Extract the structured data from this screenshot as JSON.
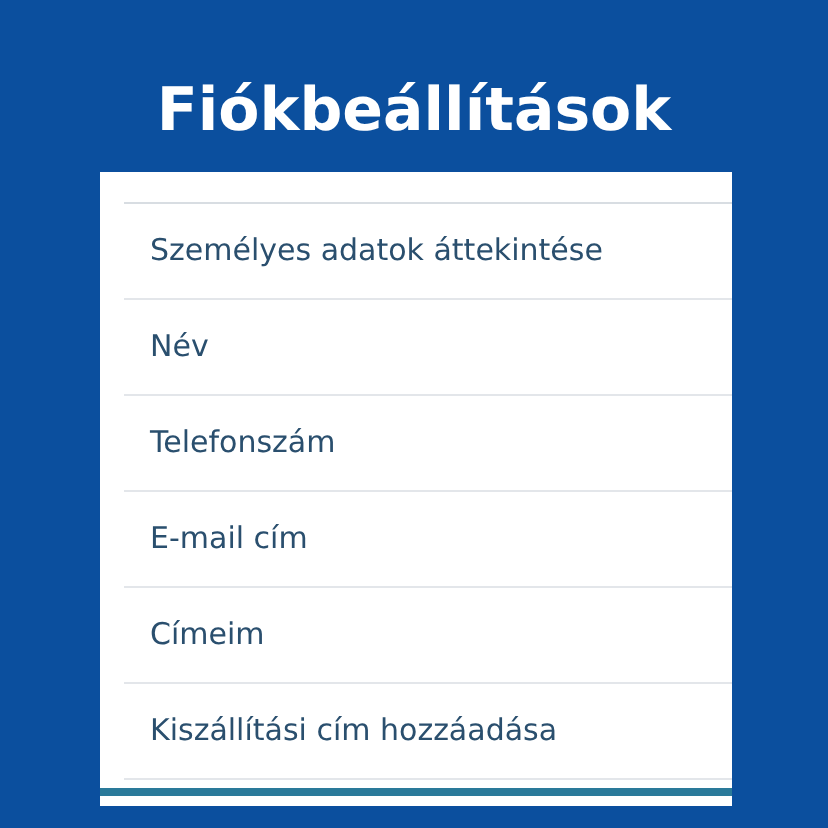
{
  "title": "Fiókbeállítások",
  "menu_items": [
    {
      "label": "Személyes adatok áttekintése"
    },
    {
      "label": "Név"
    },
    {
      "label": "Telefonszám"
    },
    {
      "label": "E-mail cím"
    },
    {
      "label": "Címeim"
    },
    {
      "label": "Kiszállítási cím hozzáadása"
    }
  ]
}
